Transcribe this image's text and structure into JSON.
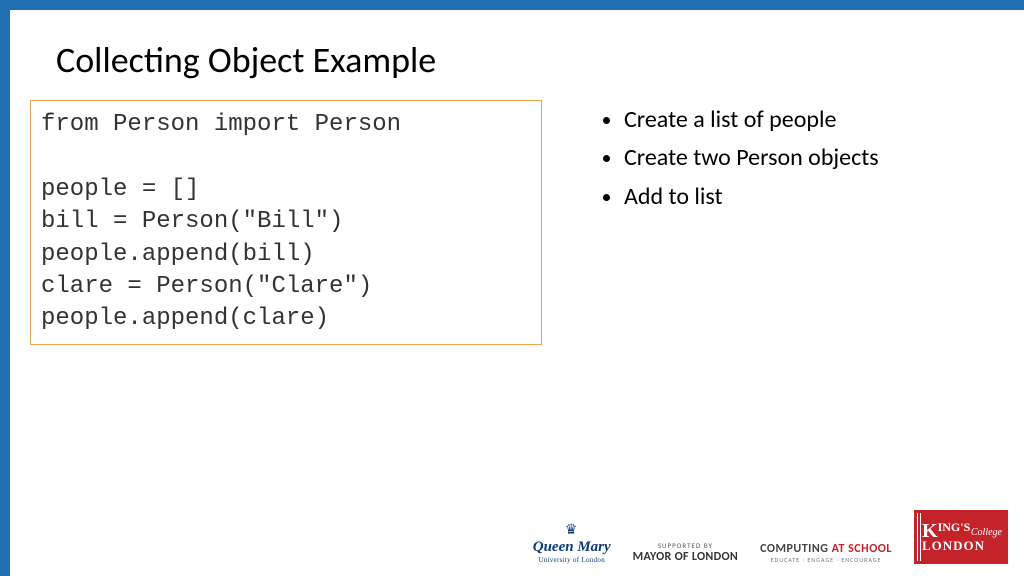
{
  "title": "Collecting Object Example",
  "code": "from Person import Person\n\npeople = []\nbill = Person(\"Bill\")\npeople.append(bill)\nclare = Person(\"Clare\")\npeople.append(clare)",
  "bullets": [
    "Create a list of people",
    "Create two Person objects",
    "Add to list"
  ],
  "footer": {
    "qm_name": "Queen Mary",
    "qm_sub": "University of London",
    "mayor_sup": "SUPPORTED BY",
    "mayor_main": "MAYOR OF LONDON",
    "cas_1": "COMPUTING ",
    "cas_2": "AT SCHOOL",
    "cas_sub": "EDUCATE · ENGAGE · ENCOURAGE",
    "kcl_k": "K",
    "kcl_ings": "ING'S",
    "kcl_col": "College",
    "kcl_lon": "LONDON"
  }
}
